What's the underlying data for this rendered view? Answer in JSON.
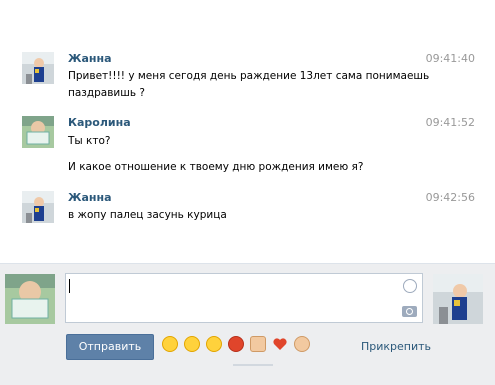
{
  "messages": [
    {
      "author": "Жанна",
      "time": "09:41:40",
      "avatar": "zhanna-avatar",
      "lines": [
        "Привет!!!! у меня сегодя день раждение 13лет сама понимаешь",
        "паздравишь ?"
      ]
    },
    {
      "author": "Каролина",
      "time": "09:41:52",
      "avatar": "karolina-avatar",
      "lines": [
        "Ты кто?",
        "И какое отношение к твоему дню рождения имею я?"
      ]
    },
    {
      "author": "Жанна",
      "time": "09:42:56",
      "avatar": "zhanna-avatar",
      "lines": [
        "в жопу палец засунь курица"
      ]
    }
  ],
  "composer": {
    "send_label": "Отправить",
    "attach_label": "Прикрепить",
    "emojis": [
      "smile-emoji",
      "happy-emoji",
      "laugh-emoji",
      "angry-emoji",
      "thumbs-up-emoji",
      "heart-emoji",
      "ok-hand-emoji"
    ]
  },
  "colors": {
    "author": "#2b587a",
    "time": "#999999",
    "send_button": "#5e81a8",
    "composer_bg": "#edeef0"
  }
}
